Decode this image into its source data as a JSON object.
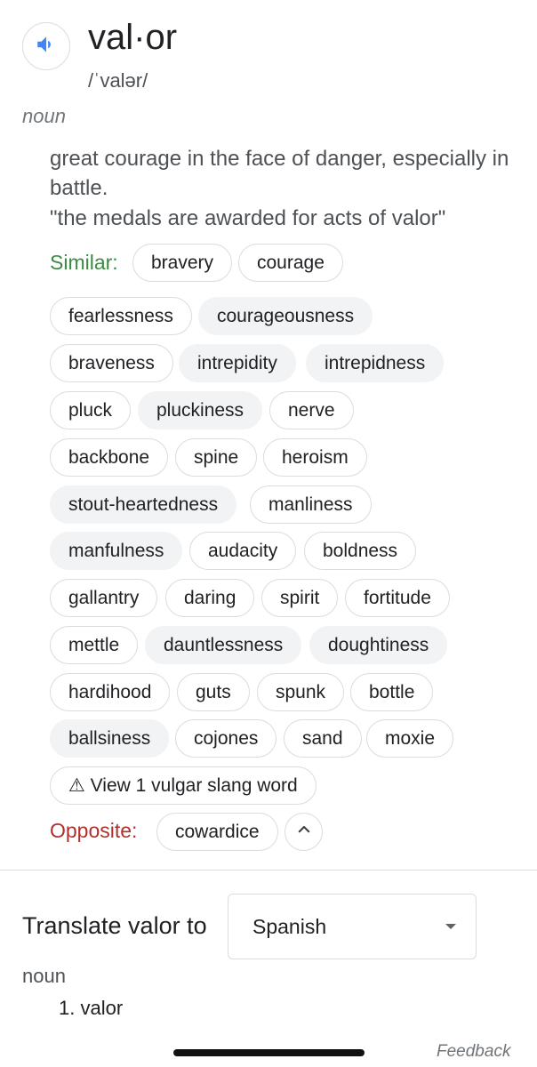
{
  "entry": {
    "word": "val·or",
    "phonetic": "/ˈvalər/",
    "part_of_speech": "noun",
    "definition": "great courage in the face of danger, especially in battle.",
    "example": "\"the medals are awarded for acts of valor\""
  },
  "similar": {
    "label": "Similar:",
    "words": [
      "bravery",
      "courage",
      "fearlessness",
      "courageousness",
      "braveness",
      "intrepidity",
      "intrepidness",
      "pluck",
      "pluckiness",
      "nerve",
      "backbone",
      "spine",
      "heroism",
      "stout-heartedness",
      "manliness",
      "manfulness",
      "audacity",
      "boldness",
      "gallantry",
      "daring",
      "spirit",
      "fortitude",
      "mettle",
      "dauntlessness",
      "doughtiness",
      "hardihood",
      "guts",
      "spunk",
      "bottle",
      "ballsiness",
      "cojones",
      "sand",
      "moxie"
    ],
    "vulgar_link": "⚠ View 1 vulgar slang word"
  },
  "opposite": {
    "label": "Opposite:",
    "words": [
      "cowardice"
    ]
  },
  "translate": {
    "label": "Translate valor to",
    "language": "Spanish",
    "part_of_speech": "noun",
    "results": [
      "1. valor"
    ]
  },
  "feedback_label": "Feedback",
  "icons": {
    "speaker": "speaker-icon",
    "collapse": "chevron-up-icon",
    "dropdown": "caret-down-icon"
  },
  "colors": {
    "similar_label": "#3c8b43",
    "opposite_label": "#b0312b",
    "speaker_blue": "#4285f4"
  }
}
